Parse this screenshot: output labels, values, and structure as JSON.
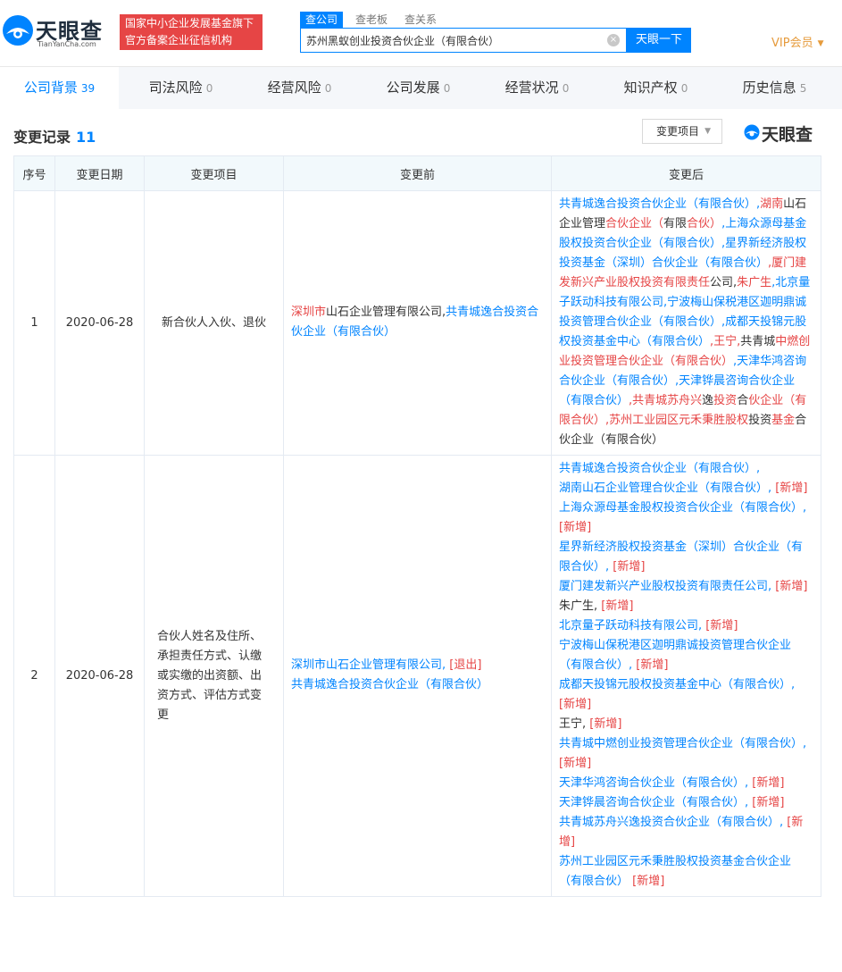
{
  "header": {
    "logo_text": "天眼查",
    "logo_url": "TianYanCha.com",
    "badge_line1": "国家中小企业发展基金旗下",
    "badge_line2": "官方备案企业征信机构",
    "search_tabs": [
      "查公司",
      "查老板",
      "查关系"
    ],
    "search_value": "苏州黑蚁创业投资合伙企业（有限合伙）",
    "clear_icon": "×",
    "search_button": "天眼一下",
    "vip_label": "VIP会员",
    "vip_caret": "▼"
  },
  "nav": {
    "tabs": [
      {
        "label": "公司背景",
        "count": "39"
      },
      {
        "label": "司法风险",
        "count": "0"
      },
      {
        "label": "经营风险",
        "count": "0"
      },
      {
        "label": "公司发展",
        "count": "0"
      },
      {
        "label": "经营状况",
        "count": "0"
      },
      {
        "label": "知识产权",
        "count": "0"
      },
      {
        "label": "历史信息",
        "count": "5"
      }
    ]
  },
  "section": {
    "title": "变更记录",
    "count": "11",
    "filter_label": "变更项目",
    "filter_caret": "▼",
    "watermark": "天眼查"
  },
  "table": {
    "headers": [
      "序号",
      "变更日期",
      "变更项目",
      "变更前",
      "变更后"
    ],
    "rows": [
      {
        "index": "1",
        "date": "2020-06-28",
        "item": "新合伙人入伙、退伙",
        "before": [
          {
            "t": "深圳市",
            "c": "r"
          },
          {
            "t": "山石企业管理有限公司,",
            "c": "k"
          },
          {
            "t": "共青城逸合投资合伙企业（有限合伙）",
            "c": "b"
          }
        ],
        "after": [
          {
            "t": "共青城逸合投资合伙企业（有限合伙）,",
            "c": "b"
          },
          {
            "t": "湖南",
            "c": "r"
          },
          {
            "t": "山石企业管理",
            "c": "k"
          },
          {
            "t": "合伙企业（",
            "c": "r"
          },
          {
            "t": "有限",
            "c": "k"
          },
          {
            "t": "合伙）",
            "c": "r"
          },
          {
            "t": ",上海众源母基金股权投资合伙企业（有限合伙）,星界新经济股权投资基金（深圳）合伙企业（有限合伙）",
            "c": "b"
          },
          {
            "t": ",厦门建发新兴产业股权投资有限责任",
            "c": "r"
          },
          {
            "t": "公司,",
            "c": "k"
          },
          {
            "t": "朱广生",
            "c": "r"
          },
          {
            "t": ",北京量子跃动科技有限公司,宁波梅山保税港区迦明鼎诚投资管理合伙企业（有限合伙）,成都天投锦元股权投资基金中心（有限合伙）",
            "c": "b"
          },
          {
            "t": ",王宁,",
            "c": "r"
          },
          {
            "t": "共青城",
            "c": "k"
          },
          {
            "t": "中燃创业投资管理合伙企业（有限合伙）",
            "c": "r"
          },
          {
            "t": ",天津华鸿咨询合伙企业（有限合伙）,天津铧晨咨询合伙企业（有限合伙）",
            "c": "b"
          },
          {
            "t": ",共青城苏舟兴",
            "c": "r"
          },
          {
            "t": "逸",
            "c": "k"
          },
          {
            "t": "投资",
            "c": "r"
          },
          {
            "t": "合",
            "c": "k"
          },
          {
            "t": "伙企业（有限合伙）,苏州工业园区元禾秉胜股权",
            "c": "r"
          },
          {
            "t": "投资",
            "c": "k"
          },
          {
            "t": "基金",
            "c": "r"
          },
          {
            "t": "合伙企业（有限合伙）",
            "c": "k"
          }
        ]
      },
      {
        "index": "2",
        "date": "2020-06-28",
        "item": "合伙人姓名及住所、承担责任方式、认缴或实缴的出资额、出资方式、评估方式变更",
        "before": [
          {
            "t": "深圳市山石企业管理有限公司, ",
            "c": "b"
          },
          {
            "t": "[退出]",
            "c": "r"
          },
          {
            "t": "\n",
            "c": "k"
          },
          {
            "t": "共青城逸合投资合伙企业（有限合伙）",
            "c": "b"
          }
        ],
        "after": [
          {
            "t": "共青城逸合投资合伙企业（有限合伙）,",
            "c": "b"
          },
          {
            "t": "\n",
            "c": "k"
          },
          {
            "t": "湖南山石企业管理合伙企业（有限合伙）, ",
            "c": "b"
          },
          {
            "t": "[新增]",
            "c": "r"
          },
          {
            "t": "\n",
            "c": "k"
          },
          {
            "t": "上海众源母基金股权投资合伙企业（有限合伙）, ",
            "c": "b"
          },
          {
            "t": "[新增]",
            "c": "r"
          },
          {
            "t": "\n",
            "c": "k"
          },
          {
            "t": "星界新经济股权投资基金（深圳）合伙企业（有限合伙）, ",
            "c": "b"
          },
          {
            "t": "[新增]",
            "c": "r"
          },
          {
            "t": "\n",
            "c": "k"
          },
          {
            "t": "厦门建发新兴产业股权投资有限责任公司, ",
            "c": "b"
          },
          {
            "t": "[新增]",
            "c": "r"
          },
          {
            "t": "\n",
            "c": "k"
          },
          {
            "t": "朱广生, ",
            "c": "k"
          },
          {
            "t": "[新增]",
            "c": "r"
          },
          {
            "t": "\n",
            "c": "k"
          },
          {
            "t": "北京量子跃动科技有限公司, ",
            "c": "b"
          },
          {
            "t": "[新增]",
            "c": "r"
          },
          {
            "t": "\n",
            "c": "k"
          },
          {
            "t": "宁波梅山保税港区迦明鼎诚投资管理合伙企业（有限合伙）, ",
            "c": "b"
          },
          {
            "t": "[新增]",
            "c": "r"
          },
          {
            "t": "\n",
            "c": "k"
          },
          {
            "t": "成都天投锦元股权投资基金中心（有限合伙）, ",
            "c": "b"
          },
          {
            "t": "[新增]",
            "c": "r"
          },
          {
            "t": "\n",
            "c": "k"
          },
          {
            "t": "王宁, ",
            "c": "k"
          },
          {
            "t": "[新增]",
            "c": "r"
          },
          {
            "t": "\n",
            "c": "k"
          },
          {
            "t": "共青城中燃创业投资管理合伙企业（有限合伙）, ",
            "c": "b"
          },
          {
            "t": "[新增]",
            "c": "r"
          },
          {
            "t": "\n",
            "c": "k"
          },
          {
            "t": "天津华鸿咨询合伙企业（有限合伙）, ",
            "c": "b"
          },
          {
            "t": "[新增]",
            "c": "r"
          },
          {
            "t": "\n",
            "c": "k"
          },
          {
            "t": "天津铧晨咨询合伙企业（有限合伙）, ",
            "c": "b"
          },
          {
            "t": "[新增]",
            "c": "r"
          },
          {
            "t": "\n",
            "c": "k"
          },
          {
            "t": "共青城苏舟兴逸投资合伙企业（有限合伙）, ",
            "c": "b"
          },
          {
            "t": "[新增]",
            "c": "r"
          },
          {
            "t": "\n",
            "c": "k"
          },
          {
            "t": "苏州工业园区元禾秉胜股权投资基金合伙企业（有限合伙） ",
            "c": "b"
          },
          {
            "t": "[新增]",
            "c": "r"
          }
        ]
      }
    ]
  },
  "colors": {
    "primary": "#0084ff",
    "red": "#e64545",
    "vip": "#e69b3c",
    "header_bg": "#f2f9fc",
    "nav_bg": "#f5f7fa"
  }
}
